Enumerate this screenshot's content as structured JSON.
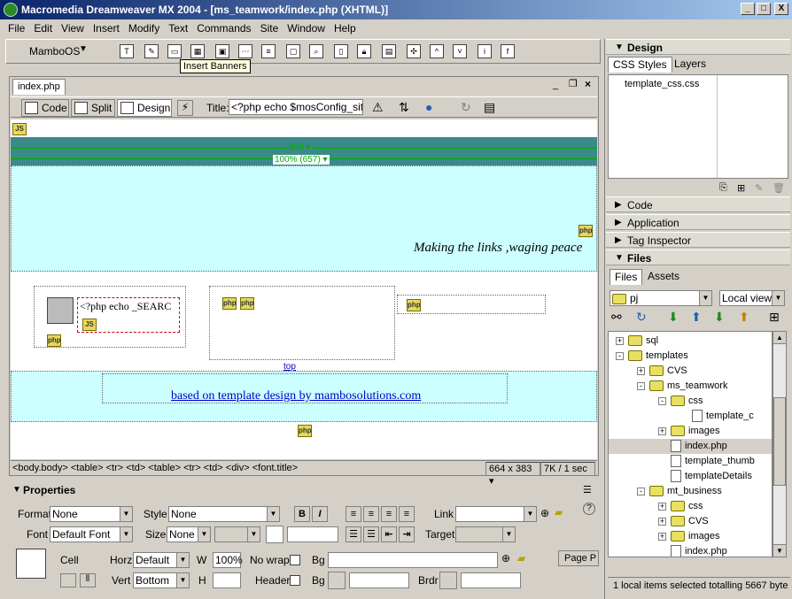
{
  "window": {
    "title": "Macromedia Dreamweaver MX 2004 - [ms_teamwork/index.php (XHTML)]",
    "minimize": "_",
    "maximize": "□",
    "close": "X"
  },
  "menu": [
    "File",
    "Edit",
    "View",
    "Insert",
    "Modify",
    "Text",
    "Commands",
    "Site",
    "Window",
    "Help"
  ],
  "insert_bar": {
    "category": "MamboOS",
    "tooltip": "Insert Banners"
  },
  "document": {
    "tab": "index.php",
    "view_code": "Code",
    "view_split": "Split",
    "view_design": "Design",
    "title_label": "Title:",
    "title_value": "<?php echo $mosConfig_sitena",
    "ruler_width": "658 ▾",
    "ruler_percent": "100% (657) ▾",
    "slogan": "Making the links ,waging peace",
    "search_text": "<?php echo _SEARC",
    "top_link": "top",
    "footer_link": "based on template design by mambosolutions.com",
    "tag_path": "<body.body> <table> <tr> <td> <table> <tr> <td> <div> <font.title>",
    "dimensions": "664 x 383 ▾",
    "size_time": "7K / 1 sec"
  },
  "properties": {
    "header": "Properties",
    "format_label": "Format",
    "format_value": "None",
    "style_label": "Style",
    "style_value": "None",
    "link_label": "Link",
    "font_label": "Font",
    "font_value": "Default Font",
    "size_label": "Size",
    "size_value": "None",
    "target_label": "Target",
    "cell_label": "Cell",
    "horz_label": "Horz",
    "horz_value": "Default",
    "w_label": "W",
    "w_value": "100%",
    "nowrap_label": "No wrap",
    "bg_label": "Bg",
    "vert_label": "Vert",
    "vert_value": "Bottom",
    "h_label": "H",
    "header_label": "Header",
    "bg2_label": "Bg",
    "brdr_label": "Brdr",
    "page_props": "Page P",
    "bold": "B",
    "italic": "I"
  },
  "panels": {
    "design": "Design",
    "css_tab": "CSS Styles",
    "layers_tab": "Layers",
    "css_file": "template_css.css",
    "code": "Code",
    "application": "Application",
    "tag_inspector": "Tag Inspector",
    "files": "Files",
    "files_tab": "Files",
    "assets_tab": "Assets",
    "site_select": "pj",
    "view_select": "Local view",
    "status": "1 local items selected totalling 5667 byte"
  },
  "file_tree": [
    {
      "name": "sql",
      "indent": 0,
      "type": "folder",
      "exp": "+"
    },
    {
      "name": "templates",
      "indent": 0,
      "type": "folder",
      "exp": "-"
    },
    {
      "name": "CVS",
      "indent": 1,
      "type": "folder",
      "exp": "+"
    },
    {
      "name": "ms_teamwork",
      "indent": 1,
      "type": "folder",
      "exp": "-"
    },
    {
      "name": "css",
      "indent": 2,
      "type": "folder",
      "exp": "-"
    },
    {
      "name": "template_c",
      "indent": 3,
      "type": "file",
      "exp": ""
    },
    {
      "name": "images",
      "indent": 2,
      "type": "folder",
      "exp": "+"
    },
    {
      "name": "index.php",
      "indent": 2,
      "type": "file",
      "exp": "",
      "selected": true
    },
    {
      "name": "template_thumb",
      "indent": 2,
      "type": "file",
      "exp": ""
    },
    {
      "name": "templateDetails",
      "indent": 2,
      "type": "file",
      "exp": ""
    },
    {
      "name": "mt_business",
      "indent": 1,
      "type": "folder",
      "exp": "-"
    },
    {
      "name": "css",
      "indent": 2,
      "type": "folder",
      "exp": "+"
    },
    {
      "name": "CVS",
      "indent": 2,
      "type": "folder",
      "exp": "+"
    },
    {
      "name": "images",
      "indent": 2,
      "type": "folder",
      "exp": "+"
    },
    {
      "name": "index.php",
      "indent": 2,
      "type": "file",
      "exp": ""
    }
  ]
}
